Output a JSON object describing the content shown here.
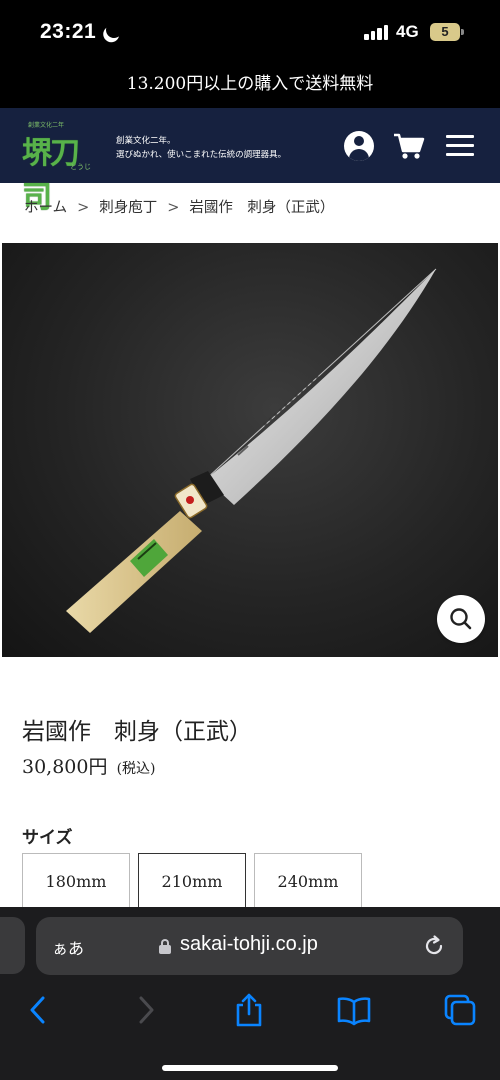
{
  "status_bar": {
    "time": "23:21",
    "network": "4G",
    "battery": "5"
  },
  "shipping_banner": "13.200円以上の購入で送料無料",
  "header": {
    "logo": {
      "name": "堺刀司",
      "small_text": "創業文化二年",
      "kana": "とうじ"
    },
    "tagline_line1": "創業文化二年。",
    "tagline_line2": "選びぬかれ、使いこまれた伝統の調理器具。",
    "icons": [
      "user-icon",
      "cart-icon",
      "menu-icon"
    ]
  },
  "breadcrumb": {
    "items": [
      "ホーム",
      "刺身庖丁",
      "岩國作　刺身（正武）"
    ],
    "separator": ">"
  },
  "product": {
    "title": "岩國作　刺身（正武）",
    "price": "30,800円",
    "tax_note": "(税込)",
    "size_label": "サイズ",
    "sizes": [
      "180mm",
      "210mm",
      "240mm"
    ],
    "selected_size": "210mm"
  },
  "browser": {
    "aa_label": "ぁあ",
    "url": "sakai-tohji.co.jp",
    "toolbar_icons": [
      "back-icon",
      "forward-icon",
      "share-icon",
      "bookmarks-icon",
      "tabs-icon"
    ]
  },
  "colors": {
    "header_bg": "#16213f",
    "logo_green": "#58b24a",
    "safari_accent": "#0a84ff",
    "browser_bg": "#1c1c1e"
  }
}
